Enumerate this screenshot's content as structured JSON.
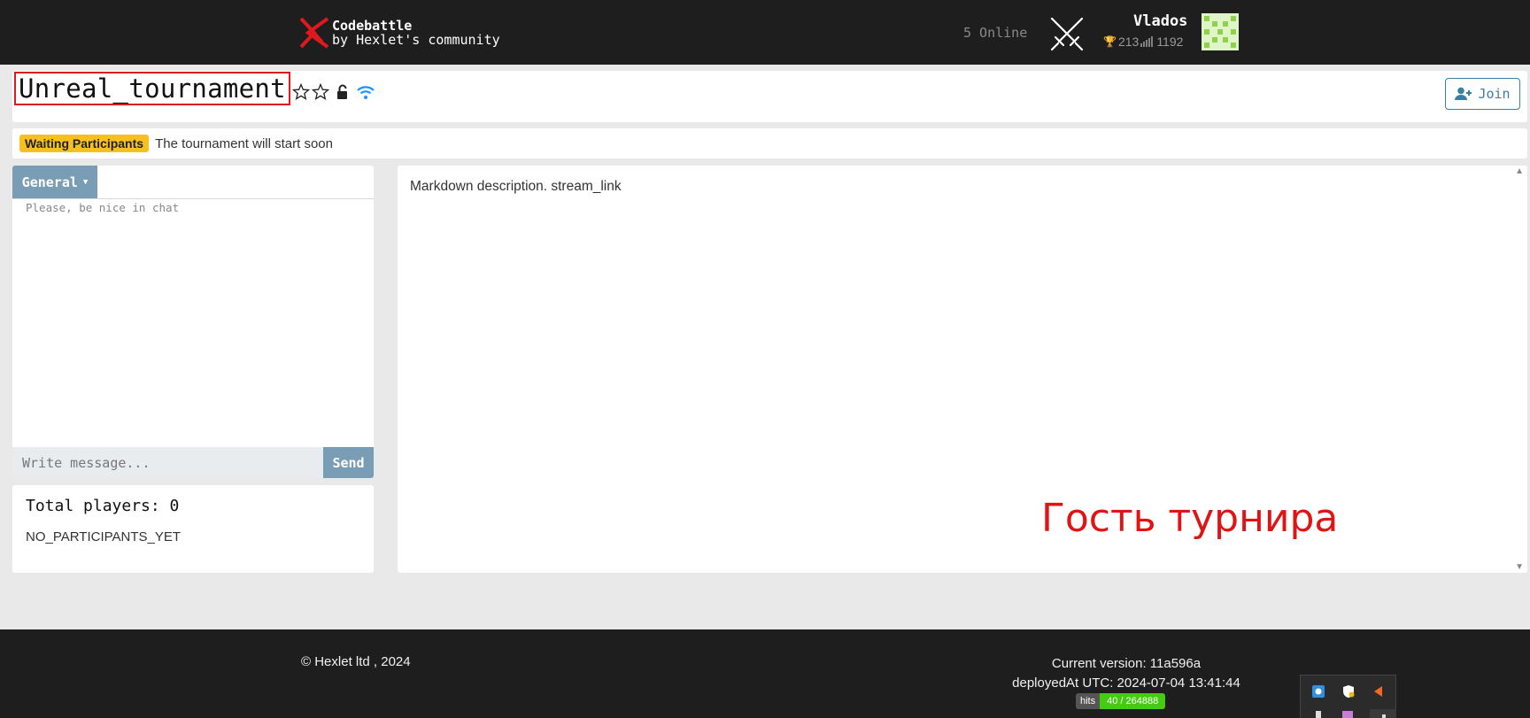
{
  "header": {
    "brand_line1": "Codebattle",
    "brand_line2": "by Hexlet's community",
    "online": "5 Online",
    "user_name": "Vlados",
    "user_rating": "213",
    "user_rank": "1192"
  },
  "title": {
    "tournament_name": "Unreal_tournament",
    "join_label": "Join"
  },
  "status": {
    "badge": "Waiting Participants",
    "message": "The tournament will start soon"
  },
  "chat": {
    "tab_label": "General",
    "notice": "Please, be nice in chat",
    "input_placeholder": "Write message...",
    "send_label": "Send"
  },
  "players": {
    "total": "Total players: 0",
    "empty": "NO_PARTICIPANTS_YET"
  },
  "description": {
    "text": "Markdown description. stream_link"
  },
  "overlay": {
    "caption": "Гость турнира"
  },
  "footer": {
    "copyright": "© Hexlet ltd , 2024",
    "version": "Current version: 11a596a",
    "deployed": "deployedAt UTC: 2024-07-04 13:41:44",
    "hits_label": "hits",
    "hits_value": "40 / 264888"
  },
  "colors": {
    "accent": "#3c7ea3",
    "tab": "#7a9db6",
    "badge": "#f7c01e",
    "highlight": "#e0191e",
    "caption": "#e01414"
  }
}
